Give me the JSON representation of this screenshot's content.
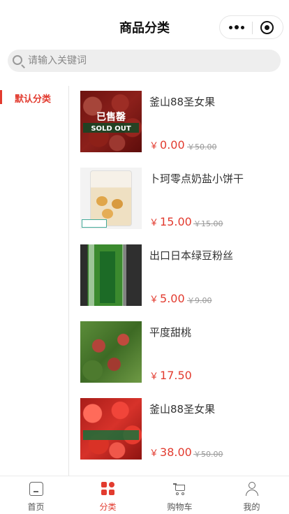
{
  "header": {
    "title": "商品分类",
    "more_icon": "more-dots-icon",
    "capsule_icon": "target-icon"
  },
  "search": {
    "placeholder": "请输入关键词",
    "icon": "search-icon"
  },
  "sidebar": {
    "items": [
      {
        "label": "默认分类",
        "active": true
      }
    ]
  },
  "products": [
    {
      "name": "釜山88圣女果",
      "price": "0.00",
      "old_price": "￥50.00",
      "sold_out": true,
      "sold_out_cn": "已售罄",
      "sold_out_en": "SOLD OUT",
      "image": "tomato"
    },
    {
      "name": "卜珂零点奶盐小饼干",
      "price": "15.00",
      "old_price": "￥15.00",
      "sold_out": false,
      "image": "biscuit"
    },
    {
      "name": "出口日本绿豆粉丝",
      "price": "5.00",
      "old_price": "￥9.00",
      "sold_out": false,
      "image": "noodle"
    },
    {
      "name": "平度甜桃",
      "price": "17.50",
      "old_price": "",
      "sold_out": false,
      "image": "peach"
    },
    {
      "name": "釜山88圣女果",
      "price": "38.00",
      "old_price": "￥50.00",
      "sold_out": false,
      "image": "tomato"
    }
  ],
  "currency": "￥",
  "tabbar": [
    {
      "label": "首页",
      "icon": "home-icon",
      "active": false
    },
    {
      "label": "分类",
      "icon": "category-icon",
      "active": true
    },
    {
      "label": "购物车",
      "icon": "cart-icon",
      "active": false
    },
    {
      "label": "我的",
      "icon": "user-icon",
      "active": false
    }
  ],
  "colors": {
    "accent": "#e23b2f",
    "muted": "#999999",
    "search_bg": "#eeeeee"
  }
}
